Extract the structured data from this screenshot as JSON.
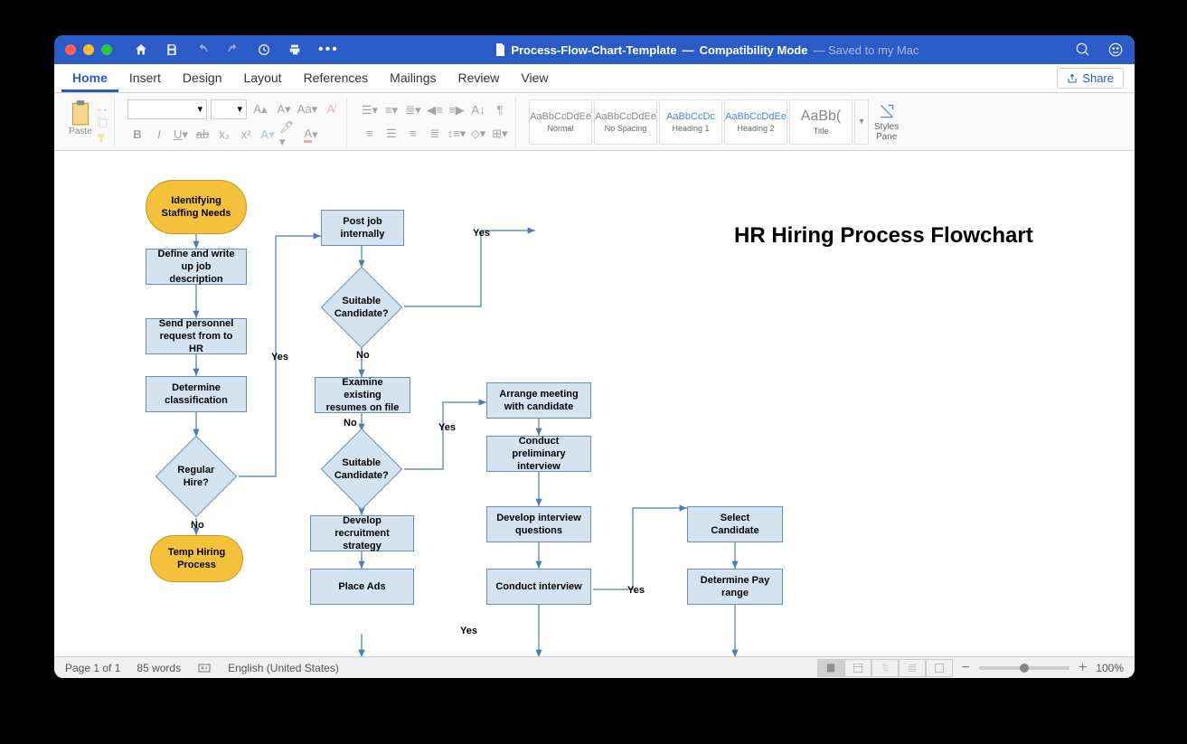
{
  "titlebar": {
    "doc_name": "Process-Flow-Chart-Template",
    "separator": " — ",
    "mode": "Compatibility Mode",
    "saved": " — Saved to my Mac"
  },
  "tabs": [
    "Home",
    "Insert",
    "Design",
    "Layout",
    "References",
    "Mailings",
    "Review",
    "View"
  ],
  "share_label": "Share",
  "ribbon": {
    "paste": "Paste",
    "styles": [
      {
        "preview": "AaBbCcDdEe",
        "name": "Normal"
      },
      {
        "preview": "AaBbCcDdEe",
        "name": "No Spacing"
      },
      {
        "preview": "AaBbCcDc",
        "name": "Heading 1"
      },
      {
        "preview": "AaBbCcDdEe",
        "name": "Heading 2"
      },
      {
        "preview": "AaBb(",
        "name": "Title"
      }
    ],
    "styles_pane": "Styles\nPane"
  },
  "flowchart": {
    "title": "HR Hiring Process Flowchart",
    "nodes": {
      "start": "Identifying\nStaffing Needs",
      "define": "Define and write up job description",
      "send": "Send personnel request from to HR",
      "determine": "Determine classification",
      "regular": "Regular Hire?",
      "temp": "Temp Hiring Process",
      "post": "Post job internally",
      "suitable1": "Suitable Candidate?",
      "examine": "Examine existing resumes on file",
      "suitable2": "Suitable Candidate?",
      "develop_recruit": "Develop recruitment strategy",
      "place_ads": "Place Ads",
      "arrange": "Arrange meeting with candidate",
      "prelim": "Conduct preliminary interview",
      "dev_questions": "Develop interview questions",
      "conduct": "Conduct interview",
      "select": "Select Candidate",
      "pay": "Determine Pay range"
    },
    "labels": {
      "yes": "Yes",
      "no": "No"
    }
  },
  "statusbar": {
    "page": "Page 1 of 1",
    "words": "85 words",
    "lang": "English (United States)",
    "zoom": "100%"
  }
}
